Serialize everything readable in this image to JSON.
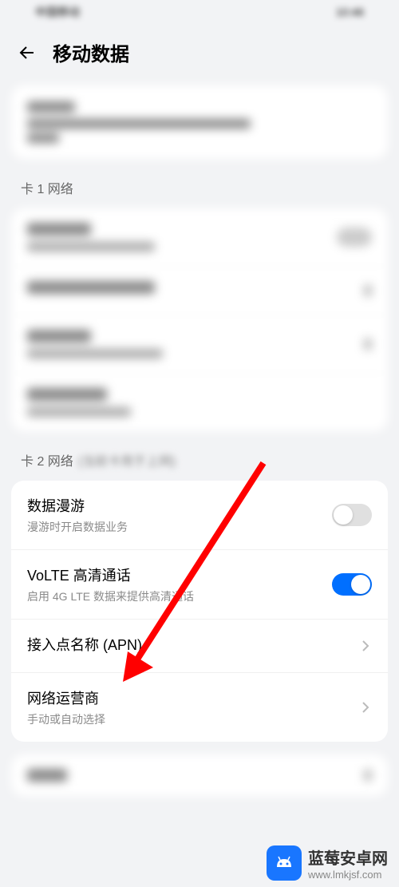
{
  "statusBar": {
    "left": "中国移动",
    "right": "10:46"
  },
  "header": {
    "title": "移动数据"
  },
  "sections": {
    "sim1": {
      "label": "卡 1 网络"
    },
    "sim2": {
      "label": "卡 2 网络",
      "items": {
        "roaming": {
          "title": "数据漫游",
          "subtitle": "漫游时开启数据业务",
          "enabled": false
        },
        "volte": {
          "title": "VoLTE 高清通话",
          "subtitle": "启用 4G LTE 数据来提供高清通话",
          "enabled": true
        },
        "apn": {
          "title": "接入点名称 (APN)"
        },
        "operator": {
          "title": "网络运营商",
          "subtitle": "手动或自动选择"
        }
      }
    }
  },
  "watermark": {
    "title": "蓝莓安卓网",
    "url": "www.lmkjsf.com"
  },
  "colors": {
    "accent": "#006fff",
    "background": "#f2f3f5",
    "arrow": "#ff0000"
  }
}
